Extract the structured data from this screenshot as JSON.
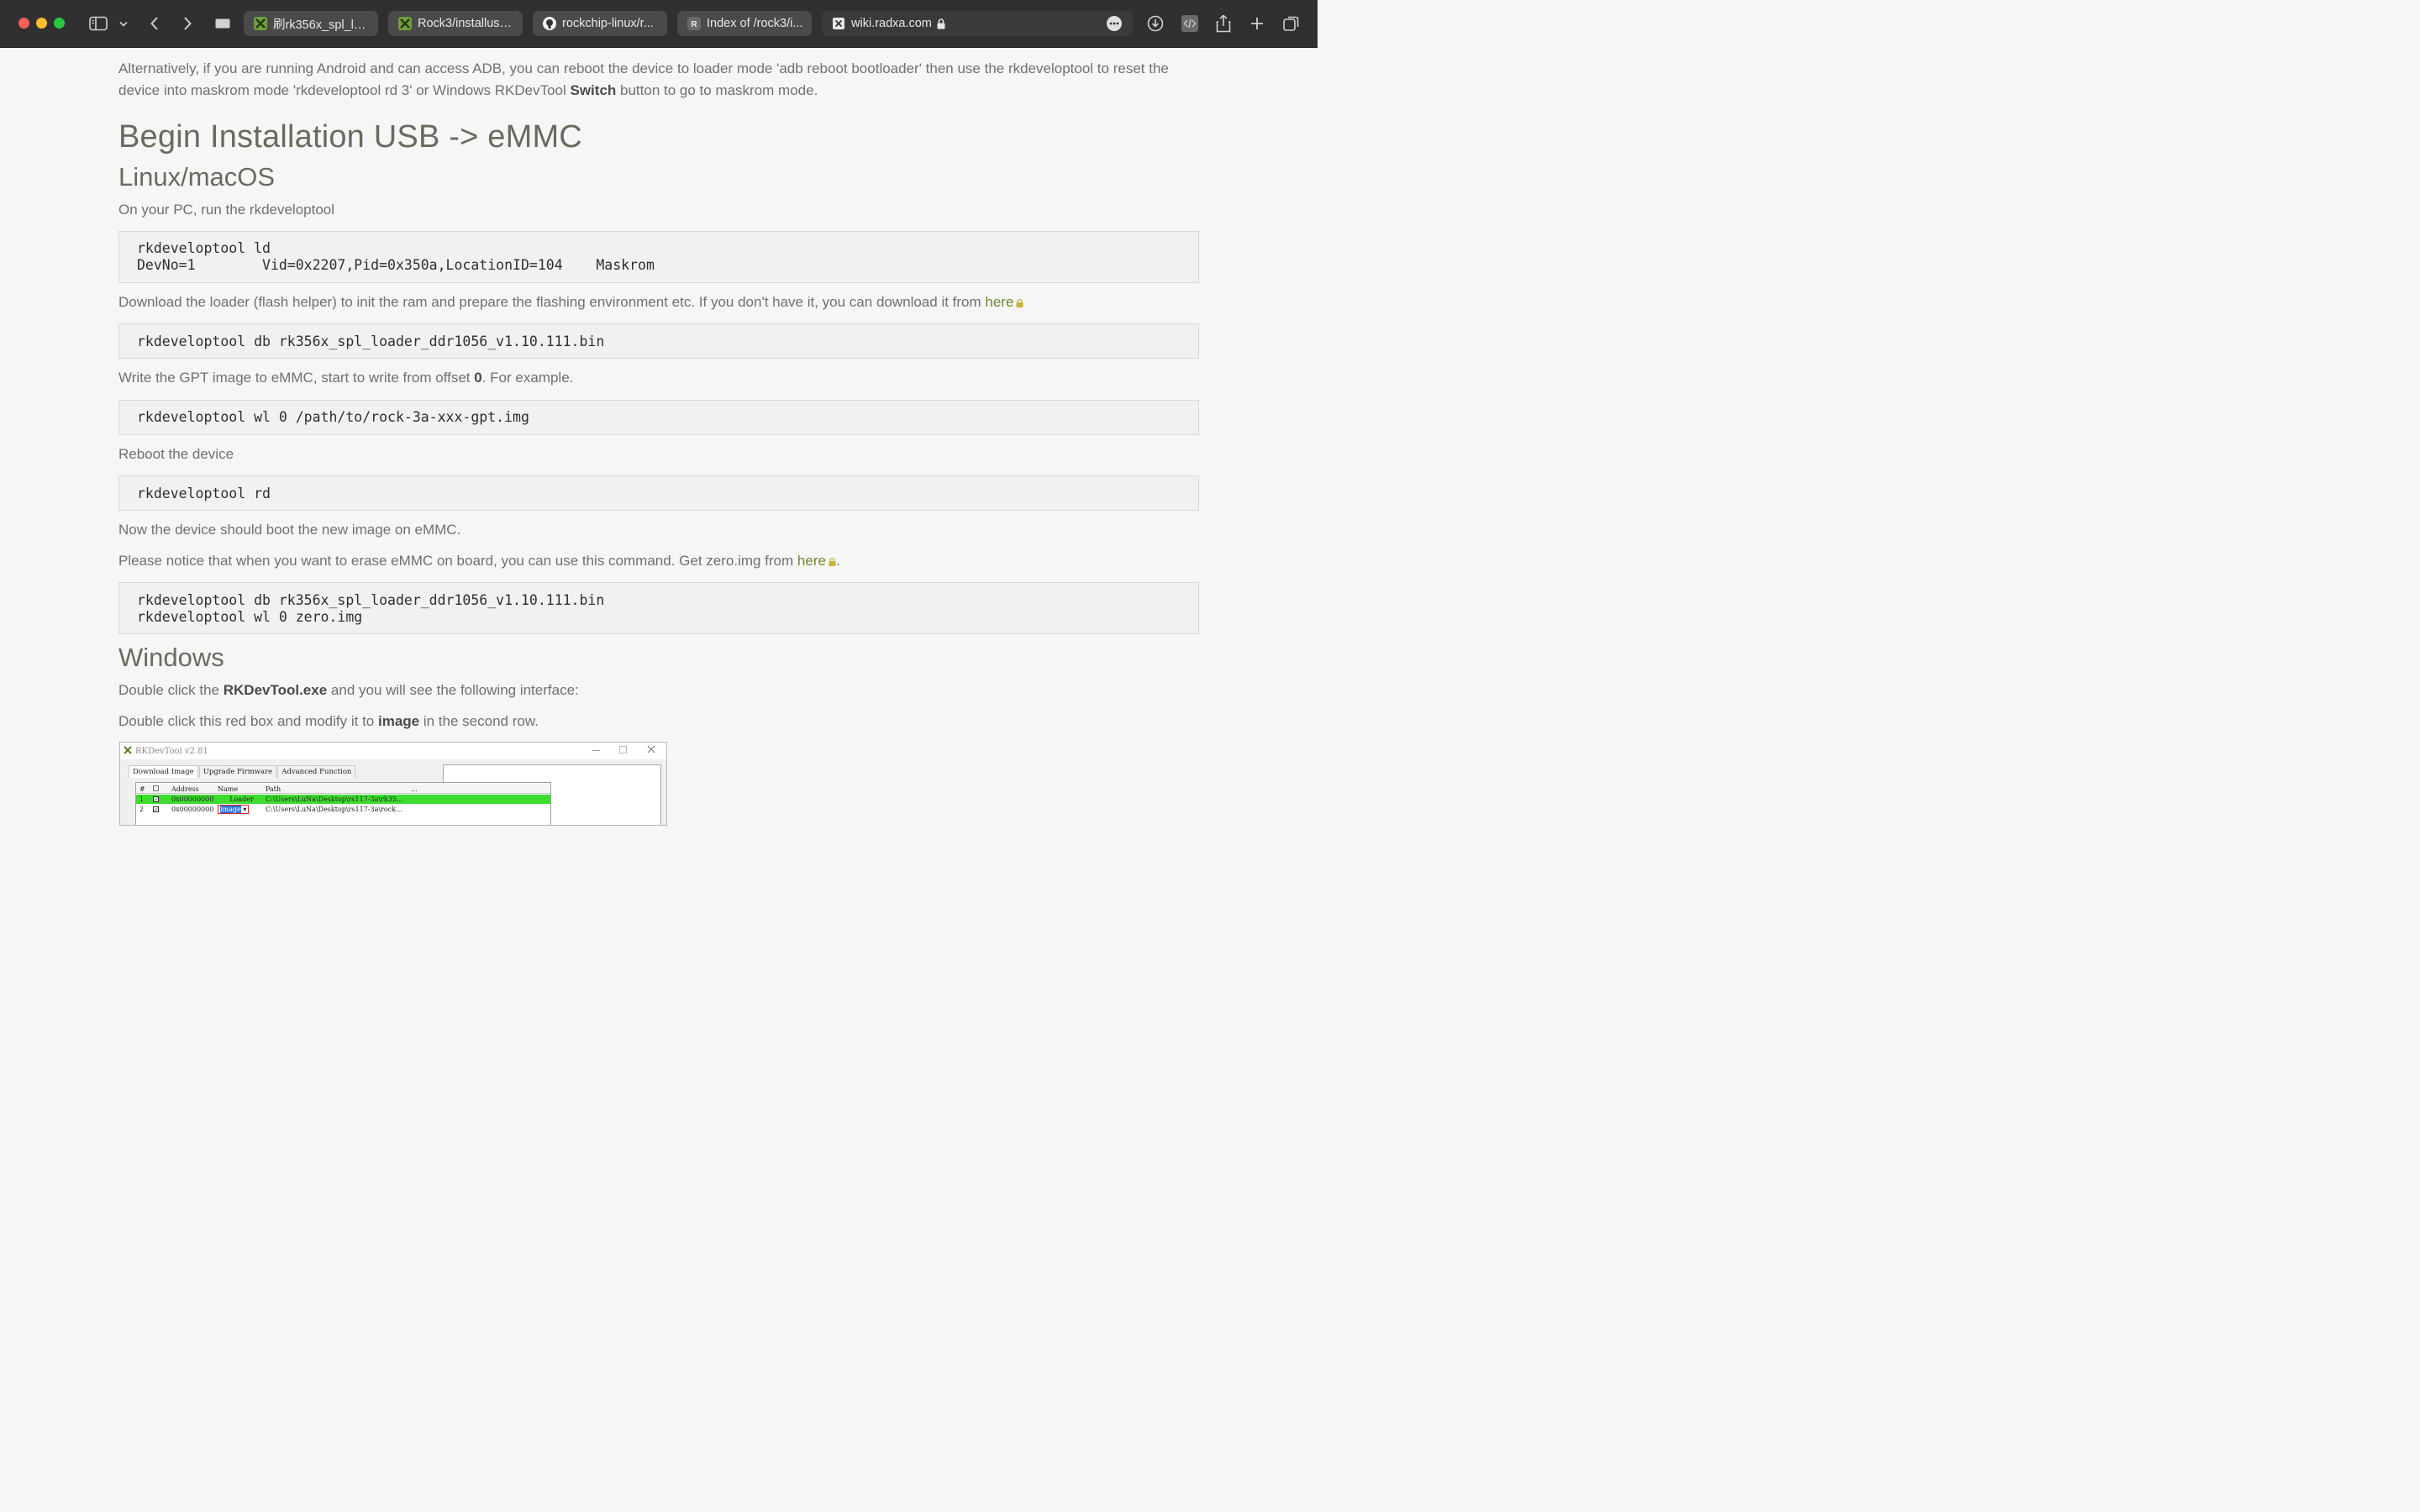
{
  "browser": {
    "tabs": [
      {
        "title": "刷rk356x_spl_lo...",
        "icon": "radxa-leaf-icon"
      },
      {
        "title": "Rock3/installusb...",
        "icon": "radxa-leaf-icon"
      },
      {
        "title": "rockchip-linux/r...",
        "icon": "github-icon"
      },
      {
        "title": "Index of /rock3/i...",
        "icon": "r-letter-icon",
        "icon_letter": "R"
      },
      {
        "title": "wiki.radxa.com",
        "icon": "site-x-icon",
        "active": true
      }
    ]
  },
  "page": {
    "intro_pre": "Alternatively, if you are running Android and can access ADB, you can reboot the device to loader mode 'adb reboot bootloader' then use the rkdeveloptool to reset the device into maskrom mode 'rkdeveloptool rd 3' or Windows RKDevTool ",
    "intro_bold": "Switch",
    "intro_post": " button to go to maskrom mode.",
    "h1": "Begin Installation USB -> eMMC",
    "h2_linux": "Linux/macOS",
    "p_run": "On your PC, run the rkdeveloptool",
    "code_ld": "rkdeveloptool ld\nDevNo=1        Vid=0x2207,Pid=0x350a,LocationID=104    Maskrom",
    "p_loader": "Download the loader (flash helper) to init the ram and prepare the flashing environment etc. If you don't have it, you can download it from ",
    "link_here_1": "here",
    "code_db": "rkdeveloptool db rk356x_spl_loader_ddr1056_v1.10.111.bin",
    "p_write_pre": "Write the GPT image to eMMC, start to write from offset ",
    "p_write_bold": "0",
    "p_write_post": ". For example.",
    "code_wl": "rkdeveloptool wl 0 /path/to/rock-3a-xxx-gpt.img",
    "p_reboot": "Reboot the device",
    "code_rd": "rkdeveloptool rd",
    "p_boot": "Now the device should boot the new image on eMMC.",
    "p_erase": "Please notice that when you want to erase eMMC on board, you can use this command. Get zero.img from ",
    "link_here_2": "here",
    "p_erase_end": ".",
    "code_erase": "rkdeveloptool db rk356x_spl_loader_ddr1056_v1.10.111.bin\nrkdeveloptool wl 0 zero.img",
    "h2_windows": "Windows",
    "p_dbl1_pre": "Double click the ",
    "p_dbl1_bold": "RKDevTool.exe",
    "p_dbl1_post": " and you will see the following interface:",
    "p_dbl2_pre": "Double click this red box and modify it to ",
    "p_dbl2_bold": "image",
    "p_dbl2_post": " in the second row."
  },
  "rkdevtool_screenshot": {
    "title": "RKDevTool v2.81",
    "tabs": [
      "Download Image",
      "Upgrade Firmware",
      "Advanced Function"
    ],
    "columns": [
      "#",
      "",
      "Address",
      "Name",
      "Path",
      "..."
    ],
    "rows": [
      {
        "num": "1",
        "address": "0x00000000",
        "name": "Loader",
        "path": "C:\\Users\\LuNa\\Desktop\\rs117-3a\\rk35..."
      },
      {
        "num": "2",
        "address": "0x00000000",
        "name": "image",
        "path": "C:\\Users\\LuNa\\Desktop\\rs117-3a\\rock..."
      }
    ]
  },
  "colors": {
    "link": "#6e8a2e",
    "chrome_bg": "#303030",
    "page_bg": "#f6f6f6",
    "code_bg": "#f1f1f1"
  }
}
